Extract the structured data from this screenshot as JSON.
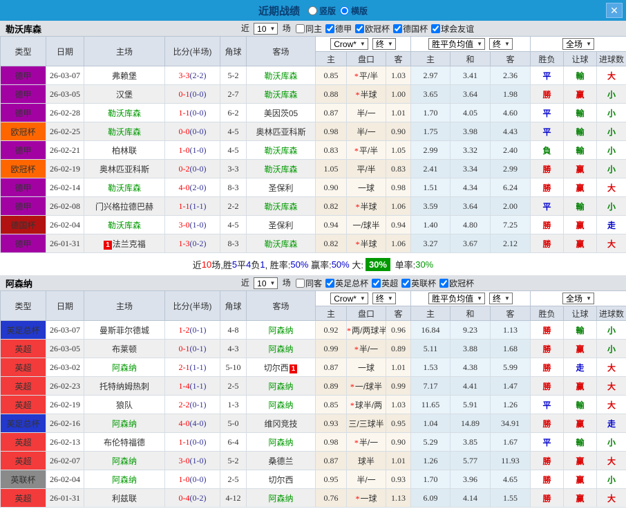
{
  "topbar": {
    "title": "近期战绩",
    "close_icon": "✕",
    "radios": [
      {
        "label": "竖版",
        "checked": false
      },
      {
        "label": "横版",
        "checked": true
      }
    ]
  },
  "table": {
    "main_headers": [
      "类型",
      "日期",
      "主场",
      "比分(半场)",
      "角球",
      "客场"
    ],
    "sub_headers": [
      "主",
      "盘口",
      "客",
      "主",
      "和",
      "客",
      "胜负",
      "让球",
      "进球数"
    ],
    "header_groups": [
      {
        "selects": [
          "Crow*",
          "终"
        ],
        "names": [
          "odds-provider-select",
          "odds-stage-select"
        ]
      },
      {
        "selects": [
          "胜平负均值",
          "终"
        ],
        "names": [
          "avg-type-select",
          "avg-stage-select"
        ]
      },
      {
        "selects": [
          "全场"
        ],
        "names": [
          "scope-select"
        ]
      }
    ]
  },
  "colors": {
    "topbar_blue": "#1e97d5",
    "team_green": "#009900",
    "score_red": "#ff0000",
    "type_badges": {
      "德甲": "#a302a3",
      "欧冠杯": "#ff6600",
      "德国杯": "#b31212",
      "英足总杯": "#2338cc",
      "英超": "#f33b3b",
      "英联杯": "#8a8a8a"
    },
    "results": {
      "勝": "#dd0000",
      "赢": "#dd0000",
      "大": "#dd0000",
      "平": "#0000cc",
      "走": "#0000cc",
      "負": "#008000",
      "輸": "#008000",
      "小": "#008000"
    }
  },
  "sections": [
    {
      "team": "勒沃库森",
      "filters": {
        "prefix": "近",
        "suffix": "场",
        "count": "10",
        "same": {
          "label": "同主",
          "checked": false
        },
        "leagues": [
          {
            "label": "德甲",
            "checked": true
          },
          {
            "label": "欧冠杯",
            "checked": true
          },
          {
            "label": "德国杯",
            "checked": true
          },
          {
            "label": "球会友谊",
            "checked": true
          }
        ]
      },
      "rows": [
        {
          "type": "德甲",
          "date": "26-03-07",
          "home": {
            "name": "弗赖堡",
            "green": false
          },
          "score": {
            "ft": "3-3",
            "ht": "(2-2)"
          },
          "corner": "5-2",
          "away": {
            "name": "勒沃库森",
            "green": true
          },
          "crow": {
            "h": "0.85",
            "star": true,
            "line": "平/半",
            "a": "1.03"
          },
          "avg": {
            "h": "2.97",
            "d": "3.41",
            "a": "2.36"
          },
          "res": {
            "o": "平",
            "h": "輸",
            "g": "大"
          }
        },
        {
          "type": "德甲",
          "date": "26-03-05",
          "home": {
            "name": "汉堡",
            "green": false
          },
          "score": {
            "ft": "0-1",
            "ht": "(0-0)"
          },
          "corner": "2-7",
          "away": {
            "name": "勒沃库森",
            "green": true
          },
          "crow": {
            "h": "0.88",
            "star": true,
            "line": "半球",
            "a": "1.00"
          },
          "avg": {
            "h": "3.65",
            "d": "3.64",
            "a": "1.98"
          },
          "res": {
            "o": "勝",
            "h": "赢",
            "g": "小"
          }
        },
        {
          "type": "德甲",
          "date": "26-02-28",
          "home": {
            "name": "勒沃库森",
            "green": true
          },
          "score": {
            "ft": "1-1",
            "ht": "(0-0)"
          },
          "corner": "6-2",
          "away": {
            "name": "美因茨05",
            "green": false
          },
          "crow": {
            "h": "0.87",
            "star": false,
            "line": "半/一",
            "a": "1.01"
          },
          "avg": {
            "h": "1.70",
            "d": "4.05",
            "a": "4.60"
          },
          "res": {
            "o": "平",
            "h": "輸",
            "g": "小"
          }
        },
        {
          "type": "欧冠杯",
          "date": "26-02-25",
          "home": {
            "name": "勒沃库森",
            "green": true
          },
          "score": {
            "ft": "0-0",
            "ht": "(0-0)"
          },
          "corner": "4-5",
          "away": {
            "name": "奥林匹亚科斯",
            "green": false
          },
          "crow": {
            "h": "0.98",
            "star": false,
            "line": "半/一",
            "a": "0.90"
          },
          "avg": {
            "h": "1.75",
            "d": "3.98",
            "a": "4.43"
          },
          "res": {
            "o": "平",
            "h": "輸",
            "g": "小"
          }
        },
        {
          "type": "德甲",
          "date": "26-02-21",
          "home": {
            "name": "柏林联",
            "green": false
          },
          "score": {
            "ft": "1-0",
            "ht": "(1-0)"
          },
          "corner": "4-5",
          "away": {
            "name": "勒沃库森",
            "green": true
          },
          "crow": {
            "h": "0.83",
            "star": true,
            "line": "平/半",
            "a": "1.05"
          },
          "avg": {
            "h": "2.99",
            "d": "3.32",
            "a": "2.40"
          },
          "res": {
            "o": "負",
            "h": "輸",
            "g": "小"
          }
        },
        {
          "type": "欧冠杯",
          "date": "26-02-19",
          "home": {
            "name": "奥林匹亚科斯",
            "green": false
          },
          "score": {
            "ft": "0-2",
            "ht": "(0-0)"
          },
          "corner": "3-3",
          "away": {
            "name": "勒沃库森",
            "green": true
          },
          "crow": {
            "h": "1.05",
            "star": false,
            "line": "平/半",
            "a": "0.83"
          },
          "avg": {
            "h": "2.41",
            "d": "3.34",
            "a": "2.99"
          },
          "res": {
            "o": "勝",
            "h": "赢",
            "g": "小"
          }
        },
        {
          "type": "德甲",
          "date": "26-02-14",
          "home": {
            "name": "勒沃库森",
            "green": true
          },
          "score": {
            "ft": "4-0",
            "ht": "(2-0)"
          },
          "corner": "8-3",
          "away": {
            "name": "圣保利",
            "green": false
          },
          "crow": {
            "h": "0.90",
            "star": false,
            "line": "一球",
            "a": "0.98"
          },
          "avg": {
            "h": "1.51",
            "d": "4.34",
            "a": "6.24"
          },
          "res": {
            "o": "勝",
            "h": "赢",
            "g": "大"
          }
        },
        {
          "type": "德甲",
          "date": "26-02-08",
          "home": {
            "name": "门兴格拉德巴赫",
            "green": false
          },
          "score": {
            "ft": "1-1",
            "ht": "(1-1)"
          },
          "corner": "2-2",
          "away": {
            "name": "勒沃库森",
            "green": true
          },
          "crow": {
            "h": "0.82",
            "star": true,
            "line": "半球",
            "a": "1.06"
          },
          "avg": {
            "h": "3.59",
            "d": "3.64",
            "a": "2.00"
          },
          "res": {
            "o": "平",
            "h": "輸",
            "g": "小"
          }
        },
        {
          "type": "德国杯",
          "date": "26-02-04",
          "home": {
            "name": "勒沃库森",
            "green": true
          },
          "score": {
            "ft": "3-0",
            "ht": "(1-0)"
          },
          "corner": "4-5",
          "away": {
            "name": "圣保利",
            "green": false
          },
          "crow": {
            "h": "0.94",
            "star": false,
            "line": "一/球半",
            "a": "0.94"
          },
          "avg": {
            "h": "1.40",
            "d": "4.80",
            "a": "7.25"
          },
          "res": {
            "o": "勝",
            "h": "赢",
            "g": "走"
          }
        },
        {
          "type": "德甲",
          "date": "26-01-31",
          "home": {
            "name": "法兰克福",
            "green": false,
            "badge": "1",
            "badge_pos": "before"
          },
          "score": {
            "ft": "1-3",
            "ht": "(0-2)"
          },
          "corner": "8-3",
          "away": {
            "name": "勒沃库森",
            "green": true
          },
          "crow": {
            "h": "0.82",
            "star": true,
            "line": "半球",
            "a": "1.06"
          },
          "avg": {
            "h": "3.27",
            "d": "3.67",
            "a": "2.12"
          },
          "res": {
            "o": "勝",
            "h": "赢",
            "g": "大"
          }
        }
      ],
      "summary": {
        "parts": [
          {
            "t": "近",
            "c": "k"
          },
          {
            "t": "10",
            "c": "r"
          },
          {
            "t": "场,胜",
            "c": "k"
          },
          {
            "t": "5",
            "c": "b"
          },
          {
            "t": "平",
            "c": "k"
          },
          {
            "t": "4",
            "c": "b"
          },
          {
            "t": "负",
            "c": "k"
          },
          {
            "t": "1",
            "c": "b"
          },
          {
            "t": ", 胜率:",
            "c": "k"
          },
          {
            "t": "50%",
            "c": "b"
          },
          {
            "t": " 赢率:",
            "c": "k"
          },
          {
            "t": "50%",
            "c": "b"
          },
          {
            "t": " 大:",
            "c": "k"
          },
          {
            "t": "30%",
            "c": "badge"
          },
          {
            "t": " 单率:",
            "c": "k"
          },
          {
            "t": "30%",
            "c": "g"
          }
        ]
      }
    },
    {
      "team": "阿森纳",
      "filters": {
        "prefix": "近",
        "suffix": "场",
        "count": "10",
        "same": {
          "label": "同客",
          "checked": false
        },
        "leagues": [
          {
            "label": "英足总杯",
            "checked": true
          },
          {
            "label": "英超",
            "checked": true
          },
          {
            "label": "英联杯",
            "checked": true
          },
          {
            "label": "欧冠杯",
            "checked": true
          }
        ]
      },
      "rows": [
        {
          "type": "英足总杯",
          "date": "26-03-07",
          "home": {
            "name": "曼斯菲尔德城",
            "green": false
          },
          "score": {
            "ft": "1-2",
            "ht": "(0-1)"
          },
          "corner": "4-8",
          "away": {
            "name": "阿森纳",
            "green": true
          },
          "crow": {
            "h": "0.92",
            "star": true,
            "line": "两/两球半",
            "a": "0.96"
          },
          "avg": {
            "h": "16.84",
            "d": "9.23",
            "a": "1.13"
          },
          "res": {
            "o": "勝",
            "h": "輸",
            "g": "小"
          }
        },
        {
          "type": "英超",
          "date": "26-03-05",
          "home": {
            "name": "布莱顿",
            "green": false
          },
          "score": {
            "ft": "0-1",
            "ht": "(0-1)"
          },
          "corner": "4-3",
          "away": {
            "name": "阿森纳",
            "green": true
          },
          "crow": {
            "h": "0.99",
            "star": true,
            "line": "半/一",
            "a": "0.89"
          },
          "avg": {
            "h": "5.11",
            "d": "3.88",
            "a": "1.68"
          },
          "res": {
            "o": "勝",
            "h": "赢",
            "g": "小"
          }
        },
        {
          "type": "英超",
          "date": "26-03-02",
          "home": {
            "name": "阿森纳",
            "green": true
          },
          "score": {
            "ft": "2-1",
            "ht": "(1-1)"
          },
          "corner": "5-10",
          "away": {
            "name": "切尔西",
            "green": false,
            "badge": "1",
            "badge_pos": "after"
          },
          "crow": {
            "h": "0.87",
            "star": false,
            "line": "一球",
            "a": "1.01"
          },
          "avg": {
            "h": "1.53",
            "d": "4.38",
            "a": "5.99"
          },
          "res": {
            "o": "勝",
            "h": "走",
            "g": "大"
          }
        },
        {
          "type": "英超",
          "date": "26-02-23",
          "home": {
            "name": "托特纳姆热刺",
            "green": false
          },
          "score": {
            "ft": "1-4",
            "ht": "(1-1)"
          },
          "corner": "2-5",
          "away": {
            "name": "阿森纳",
            "green": true
          },
          "crow": {
            "h": "0.89",
            "star": true,
            "line": "一/球半",
            "a": "0.99"
          },
          "avg": {
            "h": "7.17",
            "d": "4.41",
            "a": "1.47"
          },
          "res": {
            "o": "勝",
            "h": "赢",
            "g": "大"
          }
        },
        {
          "type": "英超",
          "date": "26-02-19",
          "home": {
            "name": "狼队",
            "green": false
          },
          "score": {
            "ft": "2-2",
            "ht": "(0-1)"
          },
          "corner": "1-3",
          "away": {
            "name": "阿森纳",
            "green": true
          },
          "crow": {
            "h": "0.85",
            "star": true,
            "line": "球半/两",
            "a": "1.03"
          },
          "avg": {
            "h": "11.65",
            "d": "5.91",
            "a": "1.26"
          },
          "res": {
            "o": "平",
            "h": "輸",
            "g": "大"
          }
        },
        {
          "type": "英足总杯",
          "date": "26-02-16",
          "home": {
            "name": "阿森纳",
            "green": true
          },
          "score": {
            "ft": "4-0",
            "ht": "(4-0)"
          },
          "corner": "5-0",
          "away": {
            "name": "维冈竞技",
            "green": false
          },
          "crow": {
            "h": "0.93",
            "star": false,
            "line": "三/三球半",
            "a": "0.95"
          },
          "avg": {
            "h": "1.04",
            "d": "14.89",
            "a": "34.91"
          },
          "res": {
            "o": "勝",
            "h": "赢",
            "g": "走"
          }
        },
        {
          "type": "英超",
          "date": "26-02-13",
          "home": {
            "name": "布伦特福德",
            "green": false
          },
          "score": {
            "ft": "1-1",
            "ht": "(0-0)"
          },
          "corner": "6-4",
          "away": {
            "name": "阿森纳",
            "green": true
          },
          "crow": {
            "h": "0.98",
            "star": true,
            "line": "半/一",
            "a": "0.90"
          },
          "avg": {
            "h": "5.29",
            "d": "3.85",
            "a": "1.67"
          },
          "res": {
            "o": "平",
            "h": "輸",
            "g": "小"
          }
        },
        {
          "type": "英超",
          "date": "26-02-07",
          "home": {
            "name": "阿森纳",
            "green": true
          },
          "score": {
            "ft": "3-0",
            "ht": "(1-0)"
          },
          "corner": "5-2",
          "away": {
            "name": "桑德兰",
            "green": false
          },
          "crow": {
            "h": "0.87",
            "star": false,
            "line": "球半",
            "a": "1.01"
          },
          "avg": {
            "h": "1.26",
            "d": "5.77",
            "a": "11.93"
          },
          "res": {
            "o": "勝",
            "h": "赢",
            "g": "大"
          }
        },
        {
          "type": "英联杯",
          "date": "26-02-04",
          "home": {
            "name": "阿森纳",
            "green": true
          },
          "score": {
            "ft": "1-0",
            "ht": "(0-0)"
          },
          "corner": "2-5",
          "away": {
            "name": "切尔西",
            "green": false
          },
          "crow": {
            "h": "0.95",
            "star": false,
            "line": "半/一",
            "a": "0.93"
          },
          "avg": {
            "h": "1.70",
            "d": "3.96",
            "a": "4.65"
          },
          "res": {
            "o": "勝",
            "h": "赢",
            "g": "小"
          }
        },
        {
          "type": "英超",
          "date": "26-01-31",
          "home": {
            "name": "利兹联",
            "green": false
          },
          "score": {
            "ft": "0-4",
            "ht": "(0-2)"
          },
          "corner": "4-12",
          "away": {
            "name": "阿森纳",
            "green": true
          },
          "crow": {
            "h": "0.76",
            "star": true,
            "line": "一球",
            "a": "1.13"
          },
          "avg": {
            "h": "6.09",
            "d": "4.14",
            "a": "1.55"
          },
          "res": {
            "o": "勝",
            "h": "赢",
            "g": "大"
          }
        }
      ],
      "summary": null
    }
  ]
}
